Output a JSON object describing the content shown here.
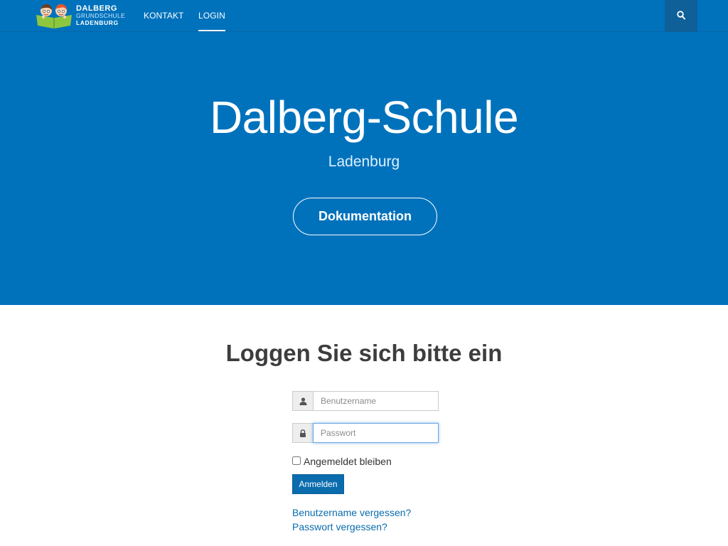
{
  "header": {
    "logo": {
      "line1": "DALBERG",
      "line2": "GRUNDSCHULE",
      "line3": "LADENBURG"
    },
    "nav": [
      {
        "label": "KONTAKT"
      },
      {
        "label": "LOGIN",
        "active": true
      }
    ],
    "search_icon": "search-icon"
  },
  "hero": {
    "title": "Dalberg-Schule",
    "subtitle": "Ladenburg",
    "button_label": "Dokumentation"
  },
  "login": {
    "heading": "Loggen Sie sich bitte ein",
    "username": {
      "placeholder": "Benutzername",
      "value": "",
      "icon": "user-icon"
    },
    "password": {
      "placeholder": "Passwort",
      "value": "",
      "icon": "lock-icon"
    },
    "remember_label": "Angemeldet bleiben",
    "remember_checked": false,
    "submit_label": "Anmelden",
    "forgot_username": "Benutzername vergessen?",
    "forgot_password": "Passwort vergessen?"
  },
  "colors": {
    "primary": "#0072bc",
    "link": "#0a6cad",
    "heading": "#3d3d3d"
  }
}
